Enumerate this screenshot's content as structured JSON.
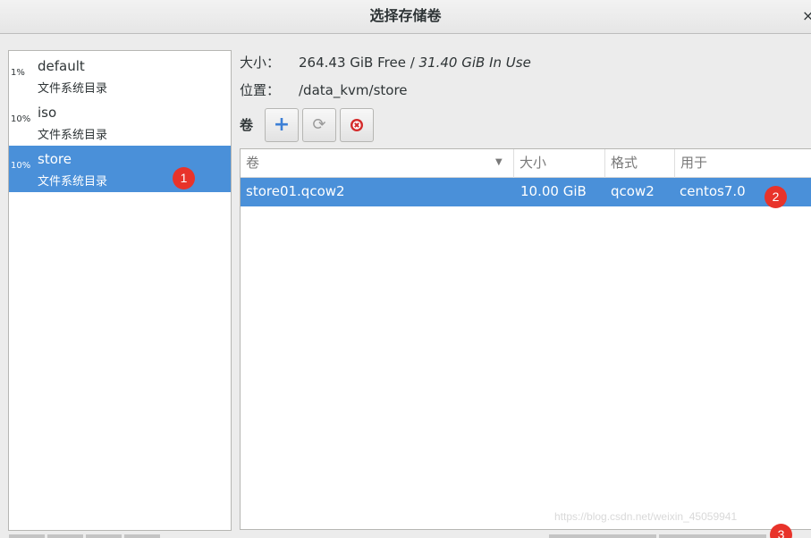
{
  "window": {
    "title": "选择存储卷",
    "close_label": "×"
  },
  "pools": [
    {
      "usage": "1%",
      "name": "default",
      "type": "文件系统目录",
      "selected": false
    },
    {
      "usage": "10%",
      "name": "iso",
      "type": "文件系统目录",
      "selected": false
    },
    {
      "usage": "10%",
      "name": "store",
      "type": "文件系统目录",
      "selected": true
    }
  ],
  "details": {
    "size_label": "大小：",
    "size_free": "264.43 GiB Free / ",
    "size_in_use": "31.40 GiB In Use",
    "location_label": "位置：",
    "location_value": "/data_kvm/store"
  },
  "volume_toolbar": {
    "label": "卷",
    "add_icon": "plus-icon",
    "refresh_icon": "refresh-icon",
    "delete_icon": "delete-icon"
  },
  "volume_table": {
    "columns": [
      "卷",
      "大小",
      "格式",
      "用于"
    ],
    "rows": [
      {
        "name": "store01.qcow2",
        "size": "10.00 GiB",
        "format": "qcow2",
        "used_by": "centos7.0"
      }
    ]
  },
  "annotations": {
    "marker1": "1",
    "marker2": "2",
    "marker3": "3"
  },
  "watermark": "https://blog.csdn.net/weixin_45059941",
  "colors": {
    "selection": "#4a90d9",
    "marker": "#e8332a"
  }
}
